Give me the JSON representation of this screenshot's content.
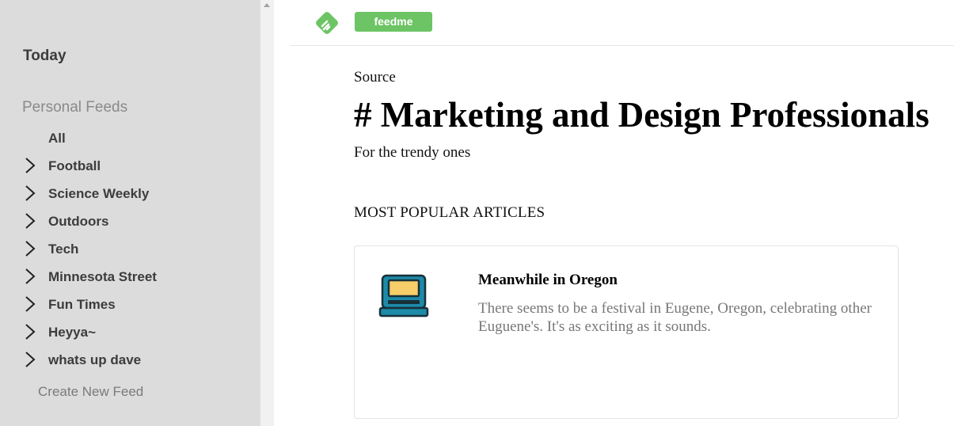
{
  "sidebar": {
    "today_label": "Today",
    "section_title": "Personal Feeds",
    "items": [
      {
        "label": "All",
        "icon": null
      },
      {
        "label": "Football",
        "icon": "chevron-right-icon"
      },
      {
        "label": "Science Weekly",
        "icon": "chevron-right-icon"
      },
      {
        "label": "Outdoors",
        "icon": "chevron-right-icon"
      },
      {
        "label": "Tech",
        "icon": "chevron-right-icon"
      },
      {
        "label": "Minnesota Street",
        "icon": "chevron-right-icon"
      },
      {
        "label": "Fun Times",
        "icon": "chevron-right-icon"
      },
      {
        "label": "Heyya~",
        "icon": "chevron-right-icon"
      },
      {
        "label": "whats up dave",
        "icon": "chevron-right-icon"
      }
    ],
    "create_label": "Create New Feed"
  },
  "header": {
    "logo_icon": "feedly-leaf-logo",
    "brand_label": "feedme",
    "brand_color": "#6cc464"
  },
  "main": {
    "eyebrow": "Source",
    "title": "# Marketing and Design Professionals",
    "subtitle": "For the trendy ones",
    "section_heading": "MOST POPULAR ARTICLES",
    "articles": [
      {
        "icon": "laptop-icon",
        "title": "Meanwhile in Oregon",
        "description": "There seems to be a festival in Eugene, Oregon, celebrating other Euguene's. It's as exciting as it sounds."
      }
    ]
  }
}
